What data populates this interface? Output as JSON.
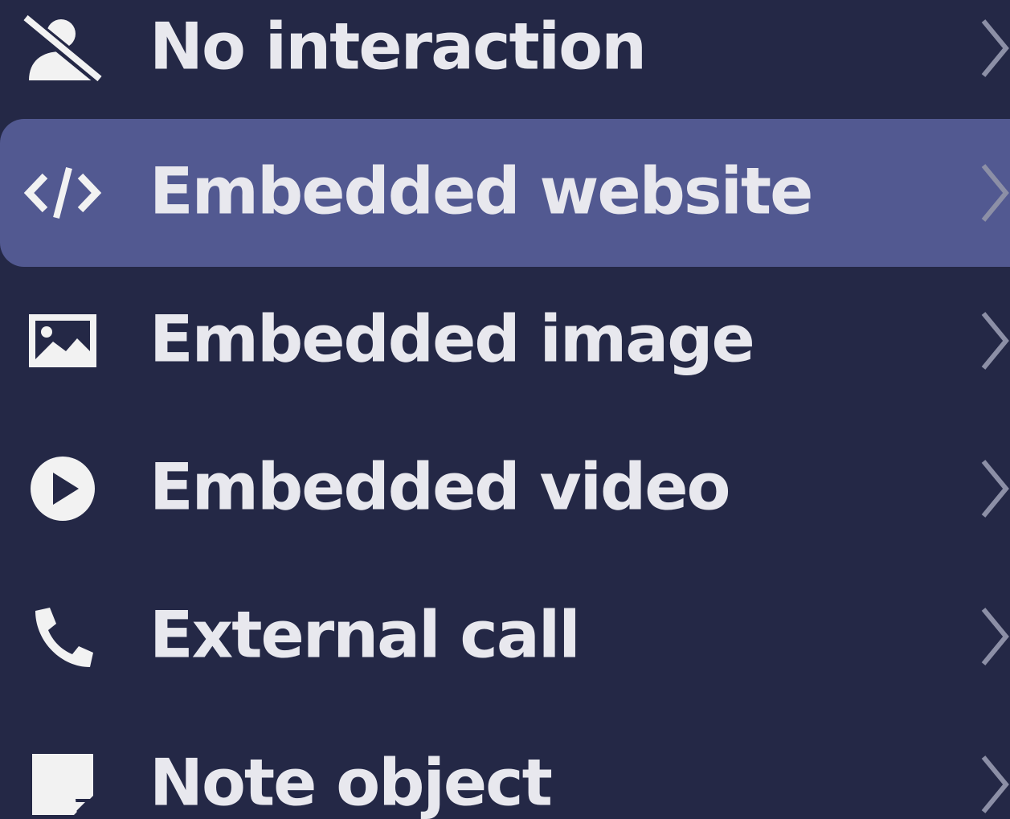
{
  "menu": {
    "items": [
      {
        "label": "No interaction",
        "icon": "user-off-icon",
        "active": false
      },
      {
        "label": "Embedded website",
        "icon": "code-icon",
        "active": true
      },
      {
        "label": "Embedded image",
        "icon": "image-icon",
        "active": false
      },
      {
        "label": "Embedded video",
        "icon": "play-circle-icon",
        "active": false
      },
      {
        "label": "External call",
        "icon": "phone-icon",
        "active": false
      },
      {
        "label": "Note object",
        "icon": "note-icon",
        "active": false
      }
    ]
  },
  "colors": {
    "background": "#242846",
    "active_background": "#525991",
    "text": "#e8e8ee",
    "chevron": "#8c8fa6"
  }
}
